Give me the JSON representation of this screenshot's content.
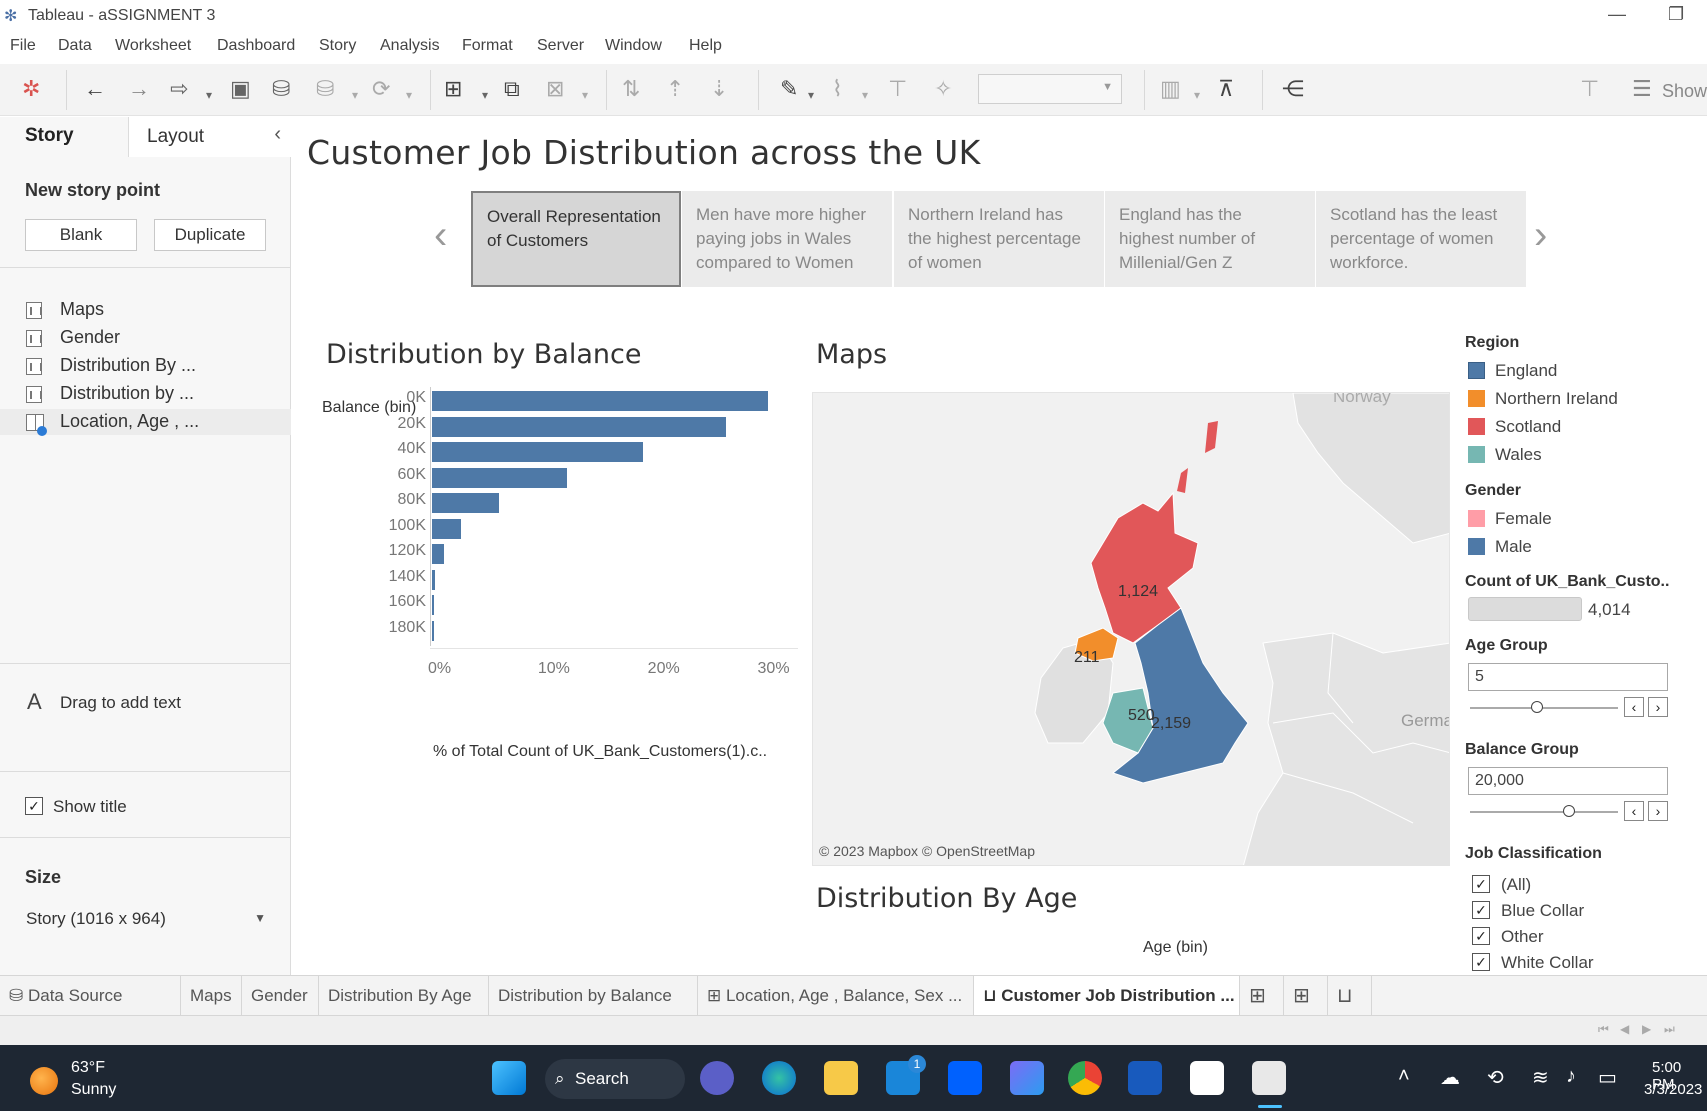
{
  "window": {
    "title": "Tableau - aSSIGNMENT 3",
    "minimize": "—",
    "restore": "❐"
  },
  "menu": [
    "File",
    "Data",
    "Worksheet",
    "Dashboard",
    "Story",
    "Analysis",
    "Format",
    "Server",
    "Window",
    "Help"
  ],
  "toolbar": {
    "show_label": "Show"
  },
  "left_panel": {
    "tab_story": "Story",
    "tab_layout": "Layout",
    "new_story_point": "New story point",
    "blank_button": "Blank",
    "duplicate_button": "Duplicate",
    "sheets": [
      "Maps",
      "Gender",
      "Distribution By ...",
      "Distribution by ...",
      "Location, Age , ..."
    ],
    "drag_text": "Drag to add text",
    "drag_icon": "A",
    "show_title": "Show title",
    "size_heading": "Size",
    "size_value": "Story (1016 x 964)"
  },
  "story": {
    "title": "Customer Job Distribution across the UK",
    "points": [
      "Overall Representation of Customers",
      "Men have more higher paying jobs in Wales compared to Women",
      "Northern Ireland has the highest percentage of women",
      "England has the highest number of Millenial/Gen Z",
      "Scotland has the least percentage of women workforce."
    ]
  },
  "balance_sheet": {
    "title": "Distribution by Balance",
    "chart_data": {
      "type": "bar",
      "orientation": "horizontal",
      "ylabel": "Balance (bin)",
      "xlabel": "% of Total Count of UK_Bank_Customers(1).c..",
      "categories": [
        "0K",
        "20K",
        "40K",
        "60K",
        "80K",
        "100K",
        "120K",
        "140K",
        "160K",
        "180K"
      ],
      "values": [
        30.6,
        26.8,
        19.2,
        12.3,
        6.1,
        2.6,
        1.1,
        0.3,
        0.1,
        0.05
      ],
      "xticks": [
        "0%",
        "10%",
        "20%",
        "30%"
      ],
      "xlim": [
        0,
        31.5
      ],
      "color": "#4e79a7"
    }
  },
  "maps_sheet": {
    "title": "Maps",
    "labels": {
      "scotland": "1,124",
      "northern_ireland": "211",
      "wales": "520",
      "england": "2,159"
    },
    "places": {
      "norway": "Norway",
      "germany": "German"
    },
    "attribution": "© 2023 Mapbox © OpenStreetMap"
  },
  "age_sheet": {
    "title": "Distribution By Age",
    "axis": "Age (bin)"
  },
  "legend": {
    "region_heading": "Region",
    "regions": [
      {
        "name": "England",
        "color": "#4e79a7"
      },
      {
        "name": "Northern Ireland",
        "color": "#f28e2b"
      },
      {
        "name": "Scotland",
        "color": "#e15759"
      },
      {
        "name": "Wales",
        "color": "#76b7b2"
      }
    ],
    "gender_heading": "Gender",
    "genders": [
      {
        "name": "Female",
        "color": "#ff9da7"
      },
      {
        "name": "Male",
        "color": "#4e79a7"
      }
    ],
    "count_heading": "Count of UK_Bank_Custo..",
    "count_value": "4,014",
    "age_group_heading": "Age Group",
    "age_group_value": "5",
    "age_group_slider": 0.45,
    "balance_group_heading": "Balance Group",
    "balance_group_value": "20,000",
    "balance_group_slider": 0.67,
    "job_heading": "Job Classification",
    "jobs": [
      "(All)",
      "Blue Collar",
      "Other",
      "White Collar"
    ]
  },
  "sheet_tabs": {
    "data_source": "Data Source",
    "tabs": [
      "Maps",
      "Gender",
      "Distribution By Age",
      "Distribution by Balance",
      "Location, Age , Balance, Sex ...",
      "Customer Job Distribution ..."
    ]
  },
  "taskbar": {
    "temp": "63°F",
    "condition": "Sunny",
    "search": "Search",
    "mail_badge": "1",
    "time": "5:00 PM",
    "date": "3/3/2023"
  }
}
